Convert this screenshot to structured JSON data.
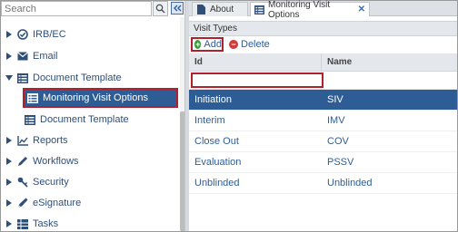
{
  "sidebar": {
    "search": {
      "placeholder": "Search",
      "value": ""
    },
    "items": [
      {
        "label": "IRB/EC",
        "icon": "check-circle-icon",
        "expanded": false
      },
      {
        "label": "Email",
        "icon": "envelope-icon",
        "expanded": false
      },
      {
        "label": "Document Template",
        "icon": "list-icon",
        "expanded": true
      },
      {
        "label": "Monitoring Visit Options",
        "icon": "list-icon",
        "selected": true
      },
      {
        "label": "Document Template",
        "icon": "list-icon"
      },
      {
        "label": "Reports",
        "icon": "chart-icon",
        "expanded": false
      },
      {
        "label": "Workflows",
        "icon": "pencil-icon",
        "expanded": false
      },
      {
        "label": "Security",
        "icon": "key-icon",
        "expanded": false
      },
      {
        "label": "eSignature",
        "icon": "pen-icon",
        "expanded": false
      },
      {
        "label": "Tasks",
        "icon": "grid-icon",
        "expanded": false
      }
    ]
  },
  "tabs": [
    {
      "label": "About",
      "active": false
    },
    {
      "label": "Monitoring Visit Options",
      "active": true
    }
  ],
  "panel": {
    "title": "Visit Types",
    "add_label": "Add",
    "delete_label": "Delete",
    "columns": [
      "Id",
      "Name"
    ],
    "rows": [
      {
        "id": "Initiation",
        "name": "SIV",
        "selected": true
      },
      {
        "id": "Interim",
        "name": "IMV"
      },
      {
        "id": "Close Out",
        "name": "COV"
      },
      {
        "id": "Evaluation",
        "name": "PSSV"
      },
      {
        "id": "Unblinded",
        "name": "Unblinded"
      }
    ]
  },
  "colors": {
    "accent": "#2e5d96",
    "highlight_border": "#b21f2d",
    "add_green": "#3a9a3a",
    "delete_red": "#d23b3b"
  }
}
